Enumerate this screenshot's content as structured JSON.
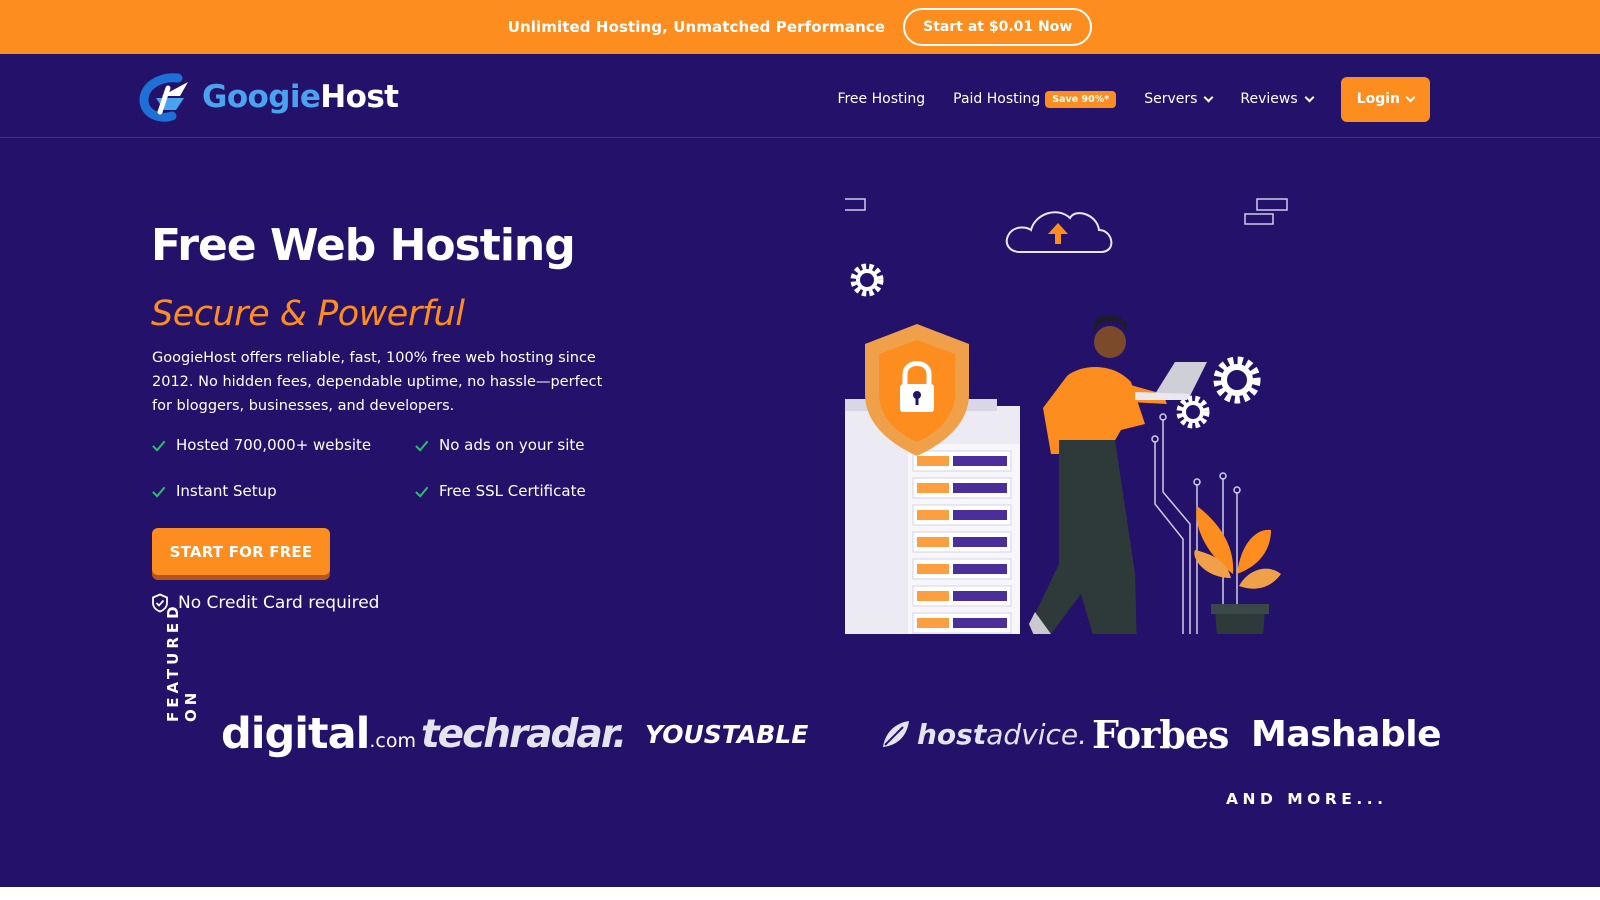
{
  "promo": {
    "text": "Unlimited Hosting, Unmatched Performance",
    "button": "Start at $0.01 Now"
  },
  "header": {
    "logo": {
      "part1": "Googie",
      "part2": "Host"
    },
    "nav": [
      {
        "label": "Free Hosting"
      },
      {
        "label": "Paid Hosting",
        "badge": "Save 90%*"
      },
      {
        "label": "Servers"
      },
      {
        "label": "Reviews"
      }
    ],
    "login": "Login"
  },
  "hero": {
    "title": "Free Web Hosting",
    "subtitle": "Secure & Powerful",
    "description": "GoogieHost offers reliable, fast, 100% free web hosting since 2012. No hidden fees, dependable uptime, no hassle—perfect for bloggers, businesses, and developers.",
    "features": [
      "Hosted 700,000+ website",
      "No ads on your site",
      "Instant Setup",
      "Free SSL Certificate"
    ],
    "cta": "START FOR FREE",
    "note": "No Credit Card required"
  },
  "featured": {
    "label": "FEATURED ON",
    "brands": {
      "digital": "digital",
      "digital_suffix": ".com",
      "techradar": "techradar.",
      "youstable": "YOUSTABLE",
      "hostadvice_bold": "host",
      "hostadvice_rest": "advice.",
      "forbes": "Forbes",
      "mashable": "Mashable"
    },
    "more": "AND MORE..."
  },
  "colors": {
    "accent": "#fd8d1f",
    "background": "#24126a",
    "logo_blue": "#4aa3f0",
    "check": "#2bc46b"
  },
  "icons": {
    "check": "check-icon",
    "shield": "shield-check-icon",
    "chevron": "chevron-down-icon"
  }
}
